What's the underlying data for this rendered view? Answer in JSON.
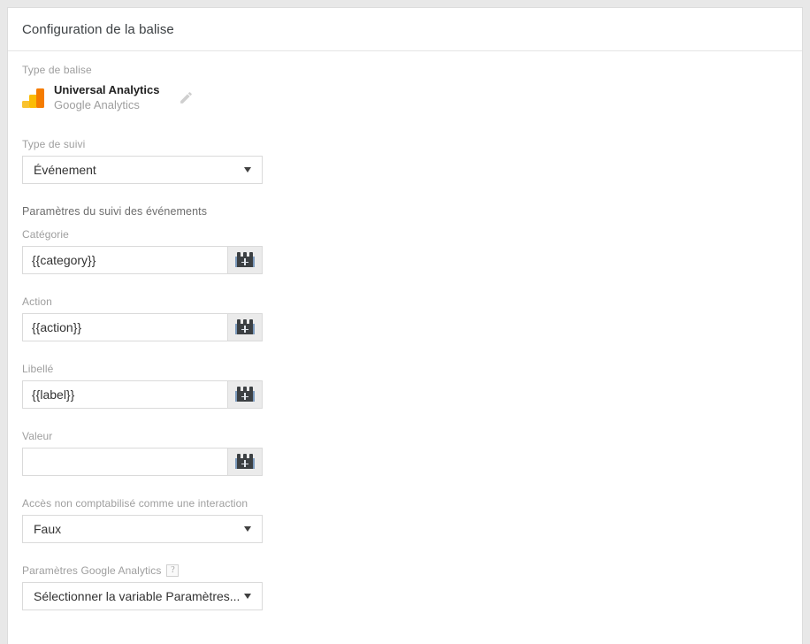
{
  "card": {
    "title": "Configuration de la balise"
  },
  "tag_type": {
    "section_label": "Type de balise",
    "name": "Universal Analytics",
    "vendor": "Google Analytics",
    "icon": "google-analytics-icon",
    "edit_icon": "pencil-icon"
  },
  "tracking_type": {
    "label": "Type de suivi",
    "value": "Événement",
    "arrow_icon": "chevron-down-icon"
  },
  "event_params": {
    "heading": "Paramètres du suivi des événements",
    "fields": [
      {
        "label": "Catégorie",
        "value": "{{category}}",
        "placeholder": "",
        "button_icon": "lego-brick-variable-icon"
      },
      {
        "label": "Action",
        "value": "{{action}}",
        "placeholder": "",
        "button_icon": "lego-brick-variable-icon"
      },
      {
        "label": "Libellé",
        "value": "{{label}}",
        "placeholder": "",
        "button_icon": "lego-brick-variable-icon"
      },
      {
        "label": "Valeur",
        "value": "",
        "placeholder": "",
        "button_icon": "lego-brick-variable-icon"
      }
    ]
  },
  "non_interaction": {
    "label": "Accès non comptabilisé comme une interaction",
    "value": "Faux",
    "arrow_icon": "chevron-down-icon"
  },
  "ga_settings": {
    "label": "Paramètres Google Analytics",
    "help_icon": "?",
    "value": "Sélectionner la variable Paramètres...",
    "arrow_icon": "chevron-down-icon"
  },
  "colors": {
    "page_background": "#e8e8e8",
    "card_background": "#ffffff",
    "border": "#dadada",
    "label_text": "#9e9e9e",
    "value_text": "#333333",
    "title_text": "#3c4043",
    "ga_orange": "#f57c00",
    "ga_yellow": "#fbbc04",
    "variable_button_bg": "#ebebeb"
  }
}
